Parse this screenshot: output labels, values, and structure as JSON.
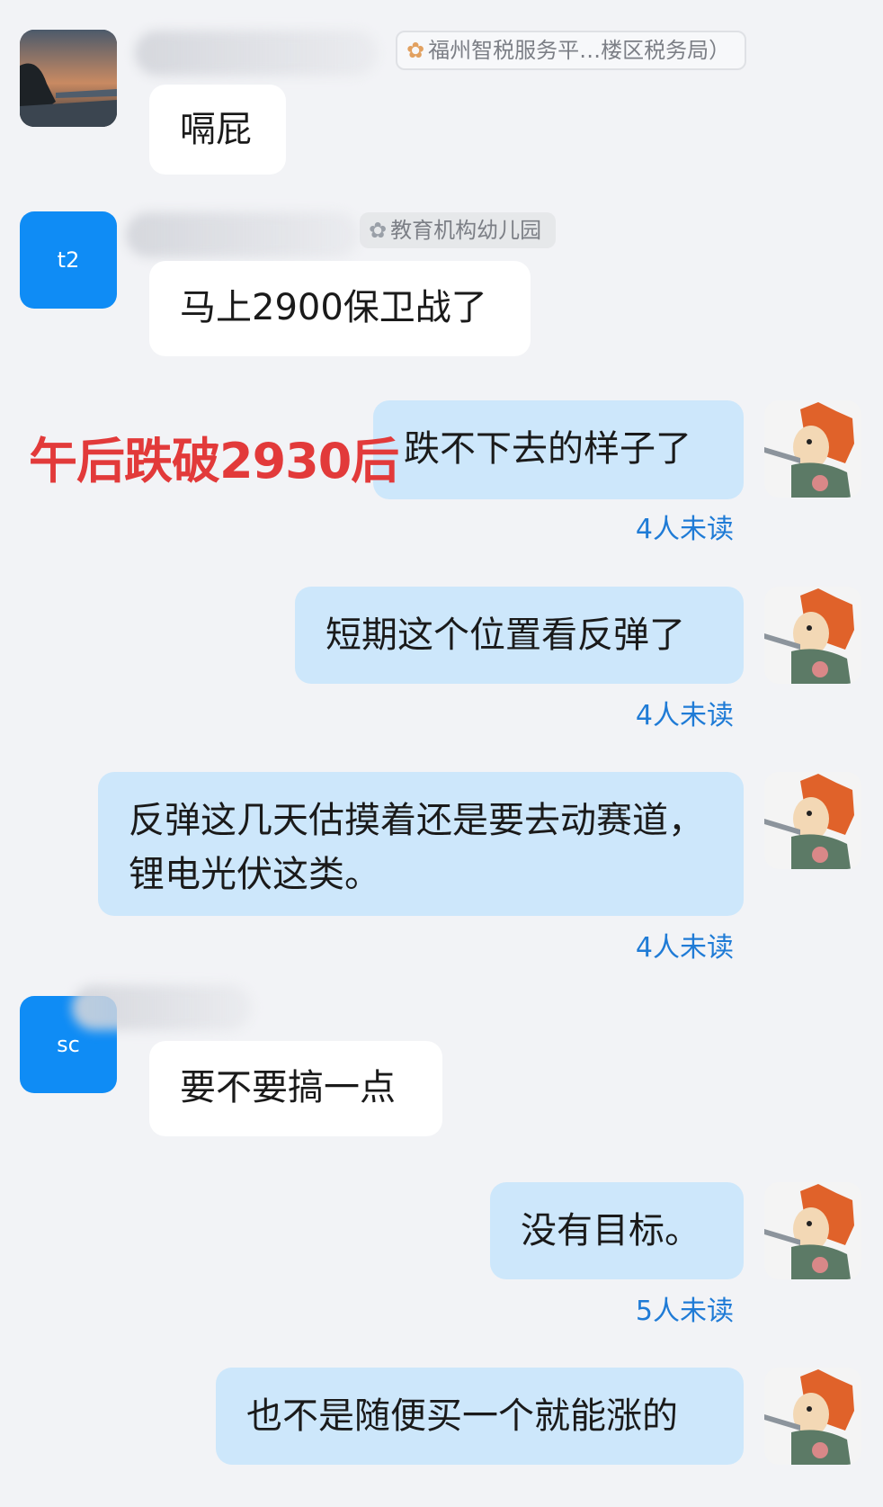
{
  "messages": [
    {
      "sender_group": "福州智税服务平…楼区税务局）",
      "avatar_text": "",
      "text": "嗝屁"
    },
    {
      "sender_group": "教育机构幼儿园",
      "avatar_text": "t2",
      "text": "马上2900保卫战了"
    },
    {
      "text": "跌不下去的样子了",
      "unread": "4人未读"
    },
    {
      "text": "短期这个位置看反弹了",
      "unread": "4人未读"
    },
    {
      "text": "反弹这几天估摸着还是要去动赛道，锂电光伏这类。",
      "unread": "4人未读"
    },
    {
      "sender_group": "",
      "avatar_text": "sc",
      "text": "要不要搞一点"
    },
    {
      "text": "没有目标。",
      "unread": "5人未读"
    },
    {
      "text": "也不是随便买一个就能涨的",
      "unread": ""
    }
  ],
  "overlay_note": "午后跌破2930后",
  "colors": {
    "accent": "#0f8cf5",
    "outgoing_bubble": "#cde7fb",
    "annotation": "#e23a3a",
    "unread": "#1f7bd6"
  },
  "icons": {
    "group_tag": "flower-icon",
    "me_avatar": "cartoon-lion-avatar"
  }
}
